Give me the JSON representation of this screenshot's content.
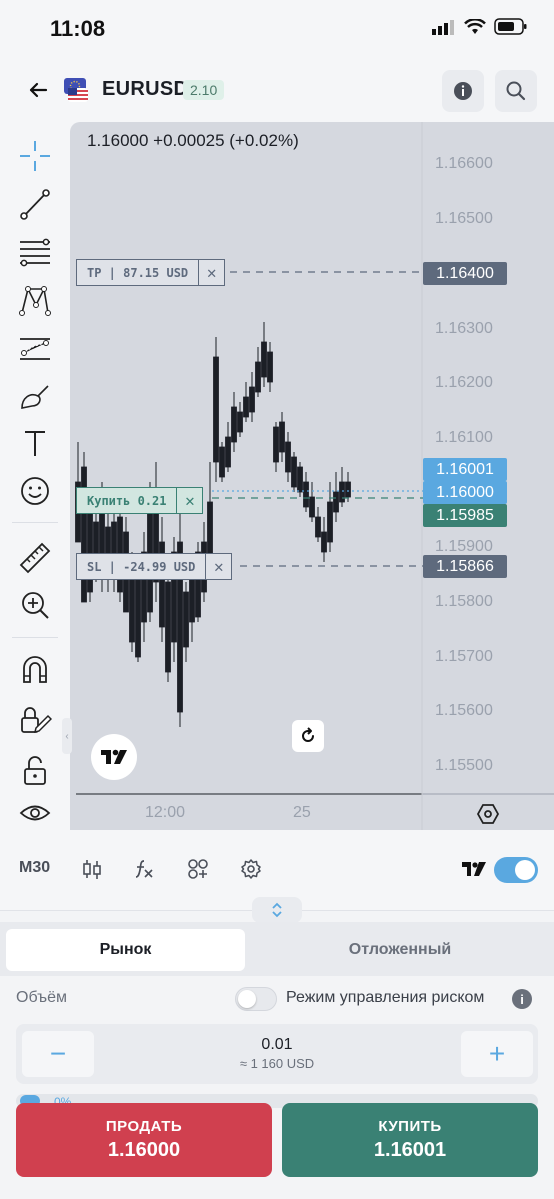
{
  "status": {
    "time": "11:08"
  },
  "header": {
    "symbol": "EURUSD",
    "spread": "2.10"
  },
  "chart": {
    "price_info": "1.16000  +0.00025 (+0.02%)",
    "price_axis": [
      "1.16600",
      "1.16500",
      "1.16300",
      "1.16200",
      "1.16100",
      "1.15900",
      "1.15800",
      "1.15700",
      "1.15600",
      "1.15500"
    ],
    "labels": {
      "tp": "1.16400",
      "ask": "1.16001",
      "bid": "1.16000",
      "entry": "1.15985",
      "sl": "1.15866"
    },
    "orders": {
      "tp": "TP | 87.15 USD",
      "buy": "Купить 0.21",
      "sl": "SL | -24.99 USD"
    },
    "time_axis": [
      "12:00",
      "25"
    ]
  },
  "controls": {
    "timeframe": "M30"
  },
  "order_panel": {
    "tabs": [
      "Рынок",
      "Отложенный"
    ],
    "volume_label": "Объём",
    "risk_label": "Режим управления риском",
    "volume_value": "0.01",
    "volume_usd": "≈ 1 160 USD",
    "slider_pct": "0%",
    "sell": {
      "label": "ПРОДАТЬ",
      "price": "1.16000"
    },
    "buy": {
      "label": "КУПИТЬ",
      "price": "1.16001"
    }
  },
  "colors": {
    "buy": "#3a8174",
    "sell": "#d0404f",
    "accent": "#5aa8e0",
    "chart_bg": "#d5d8df"
  },
  "icons": [
    "back-arrow-icon",
    "eu-flag-icon",
    "info-icon",
    "search-icon",
    "crosshair-icon",
    "trend-line-icon",
    "fib-icon",
    "pattern-icon",
    "forecast-icon",
    "brush-icon",
    "text-icon",
    "emoji-icon",
    "ruler-icon",
    "zoom-in-icon",
    "magnet-icon",
    "lock-pencil-icon",
    "unlock-icon",
    "eye-icon",
    "candles-icon",
    "fx-icon",
    "templates-icon",
    "gear-icon",
    "tradingview-icon",
    "reset-icon",
    "hexagon-settings-icon",
    "chevron-updown-icon"
  ]
}
